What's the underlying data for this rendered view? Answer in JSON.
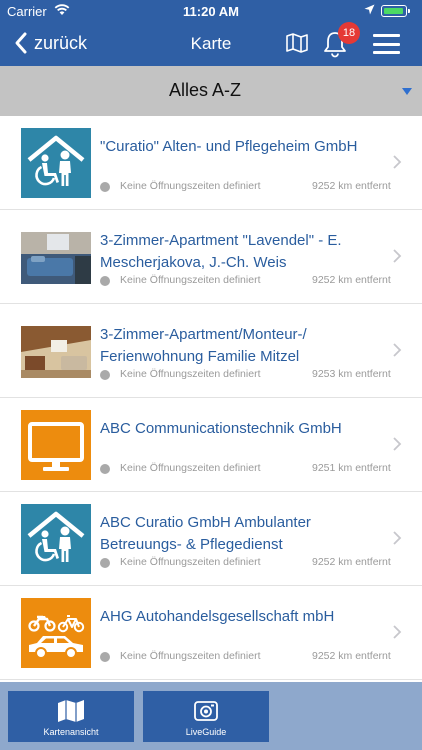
{
  "status": {
    "carrier": "Carrier",
    "time": "11:20 AM"
  },
  "nav": {
    "back_label": "zurück",
    "title": "Karte",
    "notification_count": "18"
  },
  "filter": {
    "label": "Alles A-Z"
  },
  "colors": {
    "brand": "#2f5fa5",
    "tile_blue": "#2e86a8",
    "tile_orange": "#ed8c0e",
    "link": "#2a5d9e",
    "badge": "#e53935"
  },
  "list": {
    "items": [
      {
        "name": "\"Curatio\" Alten- und Pflegeheim GmbH",
        "hours": "Keine Öffnungszeiten definiert",
        "distance": "9252 km entfernt",
        "icon": "care-home-icon"
      },
      {
        "name": "3-Zimmer-Apartment \"Lavendel\" - E. Mescherjakova, J.-Ch. Weis",
        "hours": "Keine Öffnungszeiten definiert",
        "distance": "9252 km entfernt",
        "icon": "bedroom-photo"
      },
      {
        "name": "3-Zimmer-Apartment/Monteur-/ Ferienwohnung Familie Mitzel",
        "hours": "Keine Öffnungszeiten definiert",
        "distance": "9253 km entfernt",
        "icon": "living-room-photo"
      },
      {
        "name": "ABC Communicationstechnik GmbH",
        "hours": "Keine Öffnungszeiten definiert",
        "distance": "9251 km entfernt",
        "icon": "monitor-icon"
      },
      {
        "name": "ABC Curatio GmbH Ambulanter Betreuungs- & Pflegedienst",
        "hours": "Keine Öffnungszeiten definiert",
        "distance": "9252 km entfernt",
        "icon": "care-home-icon"
      },
      {
        "name": "AHG Autohandelsgesellschaft mbH",
        "hours": "Keine Öffnungszeiten definiert",
        "distance": "9252 km entfernt",
        "icon": "vehicles-icon"
      }
    ]
  },
  "bottom": {
    "map_view_label": "Kartenansicht",
    "liveguide_label": "LiveGuide"
  }
}
